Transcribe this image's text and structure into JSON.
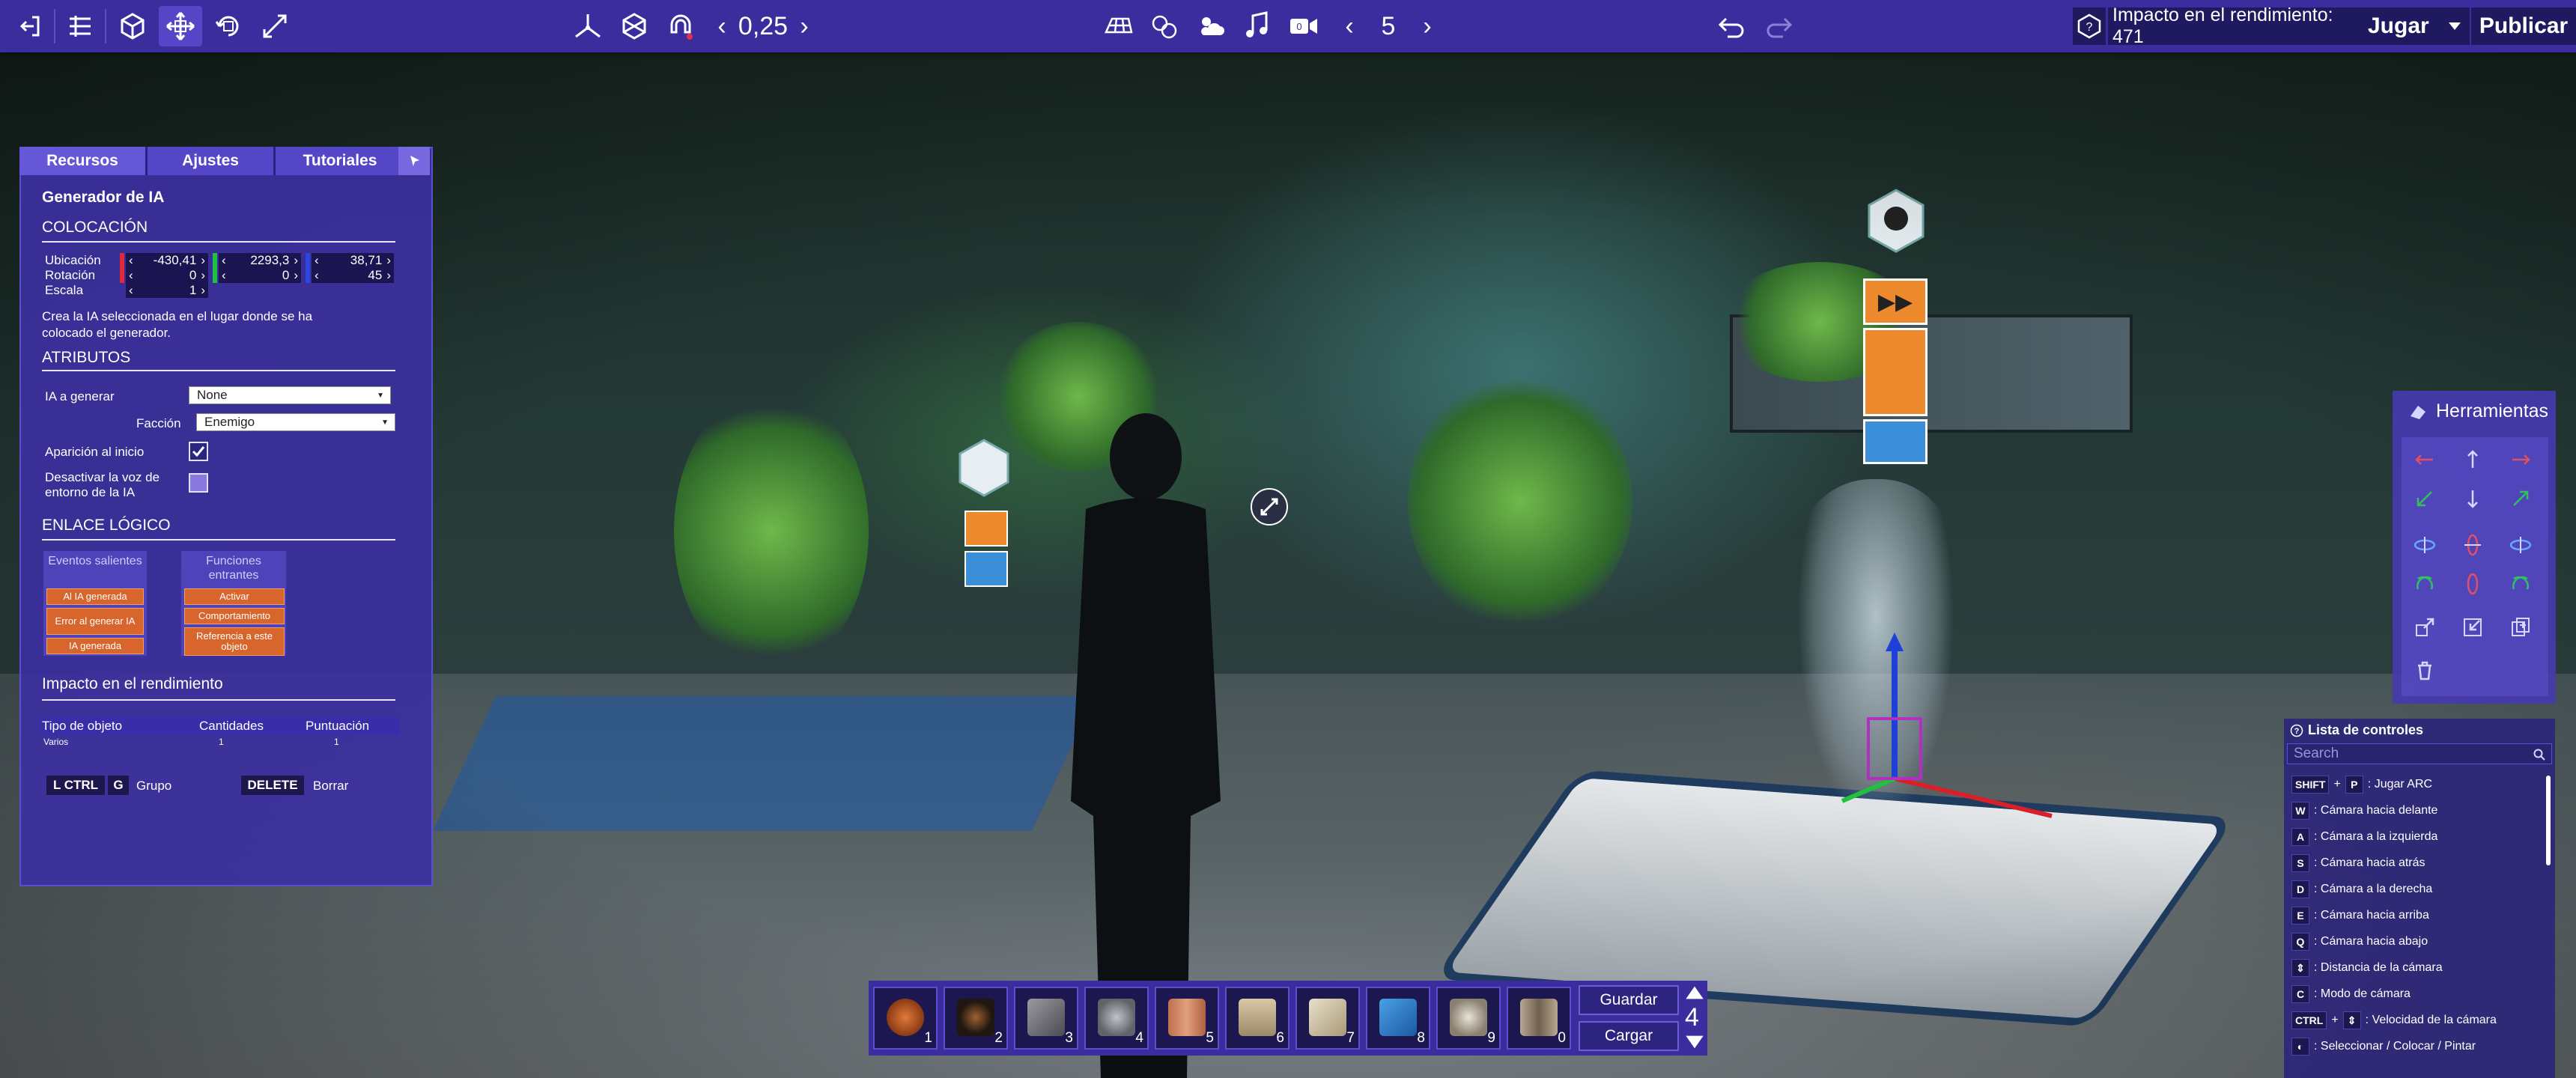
{
  "topbar": {
    "snap_value": "0,25",
    "counter_value": "5",
    "perf_label": "Impacto en el rendimiento: 471",
    "play_label": "Jugar",
    "publish_label": "Publicar"
  },
  "left_panel": {
    "tabs": [
      "Recursos",
      "Ajustes",
      "Tutoriales"
    ],
    "title": "Generador de IA",
    "placement": {
      "heading": "COLOCACIÓN",
      "location_label": "Ubicación",
      "location": [
        "-430,41",
        "2293,3",
        "38,71"
      ],
      "rotation_label": "Rotación",
      "rotation": [
        "0",
        "0",
        "45"
      ],
      "scale_label": "Escala",
      "scale": "1",
      "description": "Crea la IA seleccionada en el lugar donde se ha colocado el generador."
    },
    "attributes": {
      "heading": "ATRIBUTOS",
      "ai_label": "IA a generar",
      "ai_value": "None",
      "faction_label": "Facción",
      "faction_value": "Enemigo",
      "spawn_label": "Aparición al inicio",
      "spawn_checked": true,
      "voice_label": "Desactivar la voz de entorno de la IA",
      "voice_checked": false
    },
    "logic": {
      "heading": "ENLACE LÓGICO",
      "out_title": "Eventos salientes",
      "out_items": [
        "Al IA generada",
        "Error al generar IA",
        "IA generada"
      ],
      "in_title": "Funciones entrantes",
      "in_items": [
        "Activar",
        "Comportamiento",
        "Referencia a este objeto"
      ]
    },
    "perf": {
      "heading": "Impacto en el rendimiento",
      "col_type": "Tipo de objeto",
      "col_qty": "Cantidades",
      "col_score": "Puntuación",
      "rows": [
        {
          "type": "Varios",
          "qty": "1",
          "score": "1"
        }
      ]
    },
    "shortcuts": {
      "lctrl": "L CTRL",
      "g": "G",
      "group": "Grupo",
      "delete": "DELETE",
      "erase": "Borrar"
    }
  },
  "tools": {
    "title": "Herramientas"
  },
  "controls": {
    "title": "Lista de controles",
    "search_placeholder": "Search",
    "items": [
      {
        "keys": [
          "SHIFT",
          "+",
          "P"
        ],
        "label": ": Jugar ARC"
      },
      {
        "keys": [
          "W"
        ],
        "label": ": Cámara hacia delante"
      },
      {
        "keys": [
          "A"
        ],
        "label": ": Cámara a la izquierda"
      },
      {
        "keys": [
          "S"
        ],
        "label": ": Cámara hacia atrás"
      },
      {
        "keys": [
          "D"
        ],
        "label": ": Cámara a la derecha"
      },
      {
        "keys": [
          "E"
        ],
        "label": ": Cámara hacia arriba"
      },
      {
        "keys": [
          "Q"
        ],
        "label": ": Cámara hacia abajo"
      },
      {
        "keys": [
          "⇕"
        ],
        "label": ": Distancia de la cámara"
      },
      {
        "keys": [
          "C"
        ],
        "label": ": Modo de cámara"
      },
      {
        "keys": [
          "CTRL",
          "+",
          "⇕"
        ],
        "label": ": Velocidad de la cámara"
      },
      {
        "keys": [
          "◐"
        ],
        "label": ": Seleccionar / Colocar / Pintar"
      }
    ]
  },
  "hotbar": {
    "slots": [
      "1",
      "2",
      "3",
      "4",
      "5",
      "6",
      "7",
      "8",
      "9",
      "0"
    ],
    "save_label": "Guardar",
    "load_label": "Cargar",
    "page": "4"
  },
  "colors": {
    "bar": "#3b2d9e",
    "panel": "#3c30a0",
    "accent_orange": "#d8652c"
  }
}
